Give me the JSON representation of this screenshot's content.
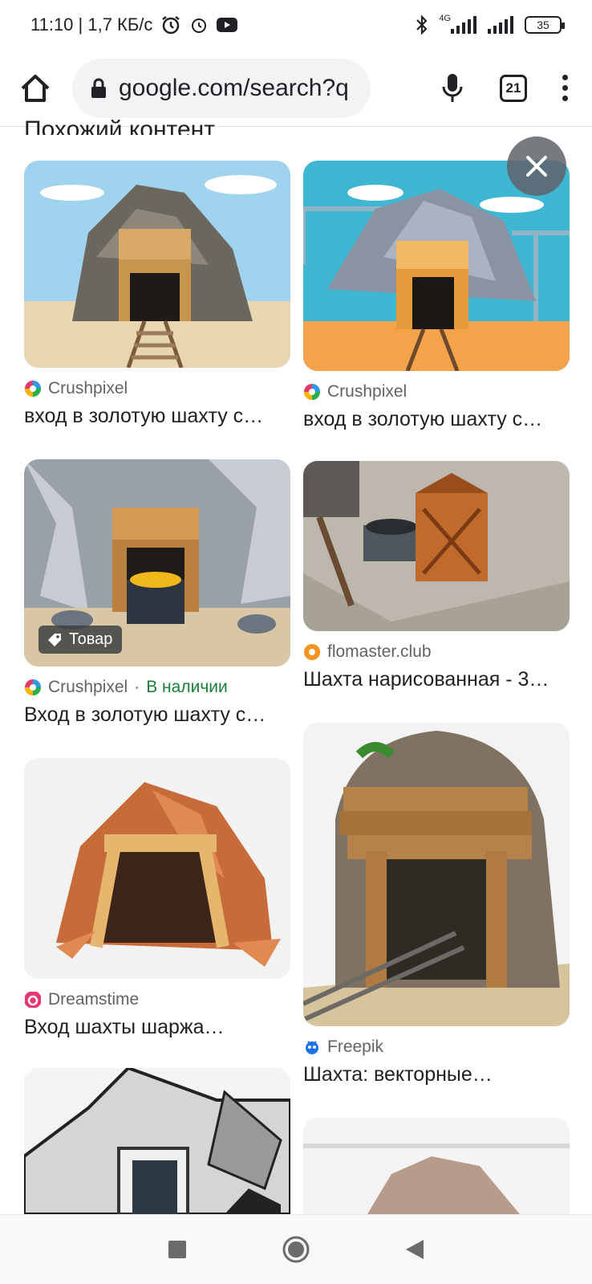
{
  "status": {
    "time_speed": "11:10 | 1,7 КБ/с",
    "network": "4G",
    "battery": "35"
  },
  "browser": {
    "url": "google.com/search?q",
    "tab_count": "21"
  },
  "section": {
    "title": "Похожий контент"
  },
  "results": [
    {
      "source": "Crushpixel",
      "title": "вход в золотую шахту с…",
      "favicon": "crushpixel-icon",
      "badge": "",
      "stock": ""
    },
    {
      "source": "Crushpixel",
      "title": "вход в золотую шахту с…",
      "favicon": "crushpixel-icon",
      "badge": "",
      "stock": ""
    },
    {
      "source": "Crushpixel",
      "title": "Вход в золотую шахту с…",
      "favicon": "crushpixel-icon",
      "badge": "Товар",
      "stock": "В наличии",
      "stock_sep": "·"
    },
    {
      "source": "flomaster.club",
      "title": "Шахта нарисованная - 3…",
      "favicon": "flomaster-icon",
      "badge": "",
      "stock": ""
    },
    {
      "source": "Dreamstime",
      "title": "Вход шахты шаржа…",
      "favicon": "dreamstime-icon",
      "badge": "",
      "stock": ""
    },
    {
      "source": "Freepik",
      "title": "Шахта: векторные…",
      "favicon": "freepik-icon",
      "badge": "",
      "stock": ""
    }
  ],
  "colors": {
    "accent_green": "#188038",
    "pill_bg": "#f1f3f4"
  }
}
